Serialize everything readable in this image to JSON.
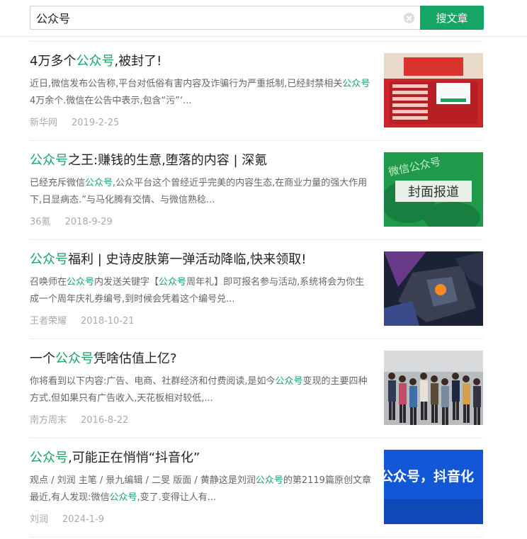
{
  "search": {
    "query": "公众号",
    "button_label": "搜文章"
  },
  "colors": {
    "accent": "#15a565"
  },
  "results": [
    {
      "title": [
        {
          "t": "4万多个",
          "h": false
        },
        {
          "t": "公众号",
          "h": true
        },
        {
          "t": ",被封了!",
          "h": false
        }
      ],
      "desc": [
        {
          "t": "近日,微信发布公告称,平台对低俗有害内容及诈骗行为严重抵制,已经封禁相关",
          "h": false
        },
        {
          "t": "公众号",
          "h": true
        },
        {
          "t": "4万余个.微信在公告中表示,包含“污”‘...",
          "h": false
        }
      ],
      "source": "新华网",
      "date": "2019-2-25",
      "thumb_icon": "red-promo-thumbnail"
    },
    {
      "title": [
        {
          "t": "公众号",
          "h": true
        },
        {
          "t": "之王:赚钱的生意,堕落的内容 | 深氪",
          "h": false
        }
      ],
      "desc": [
        {
          "t": "已经充斥微信",
          "h": false
        },
        {
          "t": "公众号",
          "h": true
        },
        {
          "t": ",公众平台这个曾经近乎完美的内容生态,在商业力量的强大作用下,日显病态.”与马化腾有交情、与微信熟稔...",
          "h": false
        }
      ],
      "source": "36氪",
      "date": "2018-9-29",
      "thumb_icon": "wechat-cover-thumbnail",
      "thumb_text": "封面报道",
      "thumb_text2": "微信公众号"
    },
    {
      "title": [
        {
          "t": "公众号",
          "h": true
        },
        {
          "t": "福利 | 史诗皮肤第一弹活动降临,快来领取!",
          "h": false
        }
      ],
      "desc": [
        {
          "t": "召唤师在",
          "h": false
        },
        {
          "t": "公众号",
          "h": true
        },
        {
          "t": "内发送关键字【",
          "h": false
        },
        {
          "t": "公众号",
          "h": true
        },
        {
          "t": "周年礼】即可报名参与活动,系统将会为你生成一个周年庆礼券编号,到时候会凭着这个编号兑...",
          "h": false
        }
      ],
      "source": "王者荣耀",
      "date": "2018-10-21",
      "thumb_icon": "game-robot-thumbnail"
    },
    {
      "title": [
        {
          "t": "一个",
          "h": false
        },
        {
          "t": "公众号",
          "h": true
        },
        {
          "t": "凭啥估值上亿?",
          "h": false
        }
      ],
      "desc": [
        {
          "t": "你将看到以下内容:广告、电商、社群经济和付费阅读,是如今",
          "h": false
        },
        {
          "t": "公众号",
          "h": true
        },
        {
          "t": "变现的主要四种方式.但如果只有广告收入,天花板相对较低,...",
          "h": false
        }
      ],
      "source": "南方周末",
      "date": "2016-8-22",
      "thumb_icon": "crowd-photo-thumbnail"
    },
    {
      "title": [
        {
          "t": "公众号",
          "h": true
        },
        {
          "t": ",可能正在悄悄“抖音化”",
          "h": false
        }
      ],
      "desc": [
        {
          "t": "观点 / 刘润 主笔 / 景九编辑 / 二旻 版面 / 黄静这是刘润",
          "h": false
        },
        {
          "t": "公众号",
          "h": true
        },
        {
          "t": "的第2119篇原创文章最近,有人发现:微信",
          "h": false
        },
        {
          "t": "公众号",
          "h": true
        },
        {
          "t": ",变了.变得让人有...",
          "h": false
        }
      ],
      "source": "刘润",
      "date": "2024-1-9",
      "thumb_icon": "blue-banner-thumbnail",
      "thumb_text": "公众号，抖音化"
    }
  ]
}
